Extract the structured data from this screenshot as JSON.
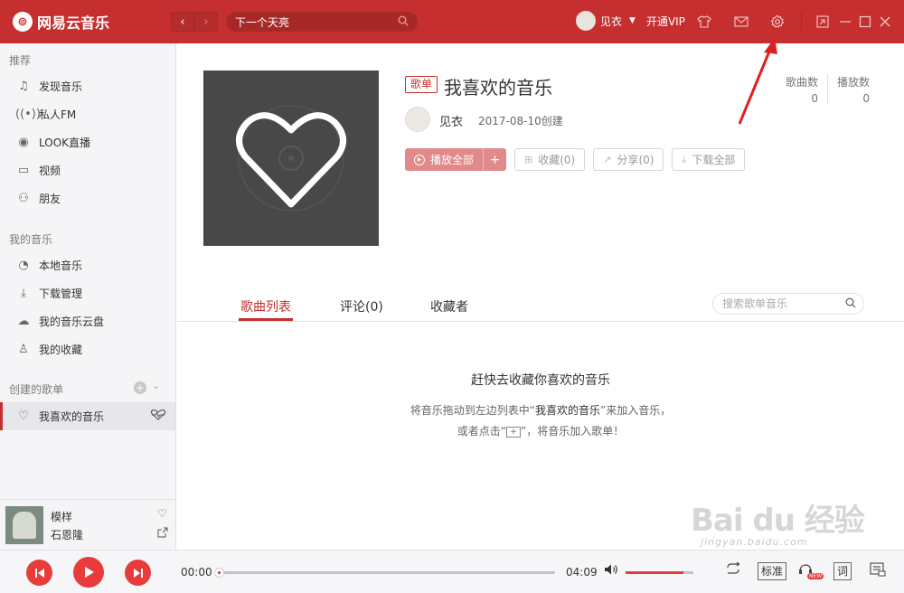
{
  "app": {
    "logo_glyph": "⊚",
    "name": "网易云音乐",
    "accent": "#c62f2f"
  },
  "topbar": {
    "back": "‹",
    "forward": "›",
    "search_value": "下一个天亮",
    "user_name": "见衣",
    "vip": "开通VIP"
  },
  "sidebar": {
    "sec_recommend": "推荐",
    "recommend": [
      {
        "label": "发现音乐",
        "icon": "music-note-icon"
      },
      {
        "label": "私人FM",
        "icon": "radio-icon"
      },
      {
        "label": "LOOK直播",
        "icon": "live-icon"
      },
      {
        "label": "视频",
        "icon": "video-icon"
      },
      {
        "label": "朋友",
        "icon": "friends-icon"
      }
    ],
    "sec_my_music": "我的音乐",
    "my_music": [
      {
        "label": "本地音乐",
        "icon": "local-music-icon"
      },
      {
        "label": "下载管理",
        "icon": "download-icon"
      },
      {
        "label": "我的音乐云盘",
        "icon": "cloud-icon"
      },
      {
        "label": "我的收藏",
        "icon": "collection-icon"
      }
    ],
    "sec_created": "创建的歌单",
    "created": [
      {
        "label": "我喜欢的音乐",
        "icon": "heart-icon"
      }
    ]
  },
  "now_playing": {
    "title": "模样",
    "artist": "石恩隆"
  },
  "playlist": {
    "badge": "歌单",
    "title": "我喜欢的音乐",
    "creator": "见衣",
    "created_date": "2017-08-10创建",
    "stats": {
      "song_count_label": "歌曲数",
      "song_count": "0",
      "play_count_label": "播放数",
      "play_count": "0"
    },
    "buttons": {
      "play_all": "播放全部",
      "collect": "收藏(0)",
      "share": "分享(0)",
      "download_all": "下载全部"
    }
  },
  "tabs": {
    "song_list": "歌曲列表",
    "comments": "评论(0)",
    "subscribers": "收藏者",
    "search_placeholder": "搜索歌单音乐"
  },
  "empty": {
    "title": "赶快去收藏你喜欢的音乐",
    "line1_a": "将音乐拖动到左边列表中“",
    "line1_b": "我喜欢的音乐",
    "line1_c": "”来加入音乐，",
    "line2_a": "或者点击“",
    "line2_b": "”，将音乐加入歌单！"
  },
  "player": {
    "current_time": "00:00",
    "total_time": "04:09",
    "progress": 0,
    "volume": 0.85,
    "quality": "标准",
    "lyrics": "词",
    "new_badge": "NEW"
  },
  "watermark": {
    "text": "Bai du 经验",
    "url": "jingyan.baidu.com"
  }
}
